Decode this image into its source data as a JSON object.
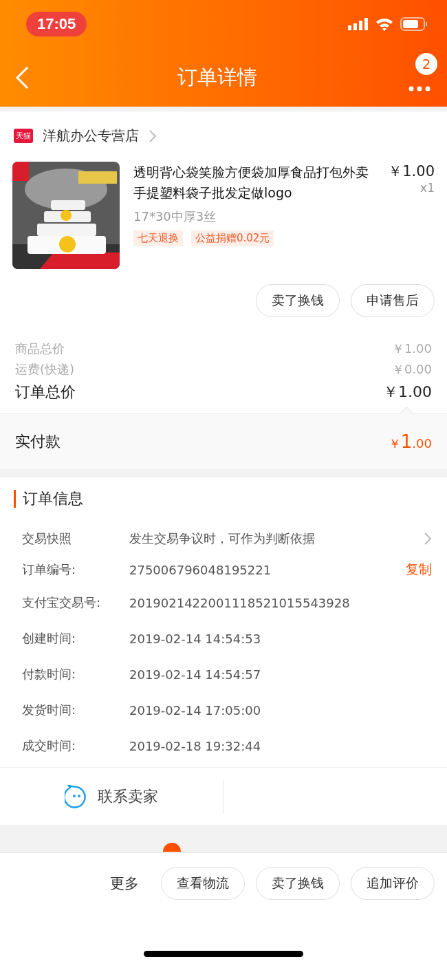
{
  "status_bar": {
    "time": "17:05"
  },
  "nav": {
    "title": "订单详情",
    "badge": "2"
  },
  "shop": {
    "tag": "天猫",
    "name": "洋航办公专营店"
  },
  "item": {
    "image": {
      "kind": "picture"
    },
    "title": "透明背心袋笑脸方便袋加厚食品打包外卖手提塑料袋子批发定做logo",
    "price": "￥1.00",
    "quantity": "x1",
    "spec": "17*30中厚3丝",
    "tags": [
      "七天退换",
      "公益捐赠0.02元"
    ],
    "actions": [
      "卖了换钱",
      "申请售后"
    ]
  },
  "totals": [
    {
      "label": "商品总价",
      "value": "￥1.00",
      "kind": "minor"
    },
    {
      "label": "运费(快递)",
      "value": "￥0.00",
      "kind": "minor"
    },
    {
      "label": "订单总价",
      "value": "￥1.00",
      "kind": "major"
    }
  ],
  "paid": {
    "label": "实付款",
    "currency": "￥",
    "integer": "1",
    "decimal": ".00"
  },
  "order_info": {
    "title": "订单信息",
    "rows": [
      {
        "label": "交易快照",
        "value": "发生交易争议时，可作为判断依据",
        "kind": "link"
      },
      {
        "label": "订单编号:",
        "value": "275006796048195221",
        "action": "复制",
        "kind": "copy"
      },
      {
        "label": "支付宝交易号:",
        "value": "2019021422001118521015543928",
        "kind": "plain"
      },
      {
        "label": "创建时间:",
        "value": "2019-02-14 14:54:53",
        "kind": "plain"
      },
      {
        "label": "付款时间:",
        "value": "2019-02-14 14:54:57",
        "kind": "plain"
      },
      {
        "label": "发货时间:",
        "value": "2019-02-14 17:05:00",
        "kind": "plain"
      },
      {
        "label": "成交时间:",
        "value": "2019-02-18 19:32:44",
        "kind": "plain"
      }
    ]
  },
  "contact": {
    "label": "联系卖家"
  },
  "bottom_bar": {
    "more": "更多",
    "buttons": [
      "查看物流",
      "卖了换钱",
      "追加评价"
    ]
  }
}
